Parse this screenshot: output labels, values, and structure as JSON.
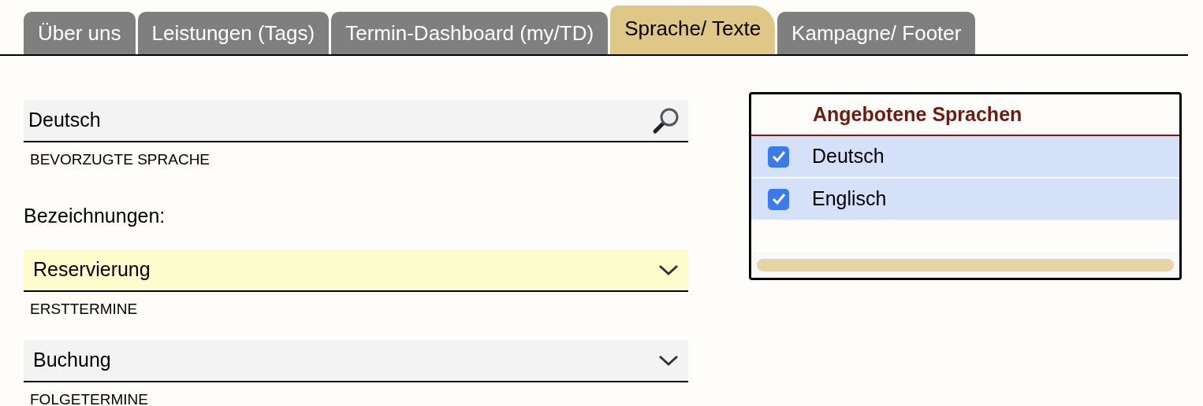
{
  "tabs": [
    {
      "label": "Über uns",
      "selected": false
    },
    {
      "label": "Leistungen (Tags)",
      "selected": false
    },
    {
      "label": "Termin-Dashboard (my/TD)",
      "selected": false
    },
    {
      "label": "Sprache/ Texte",
      "selected": true
    },
    {
      "label": "Kampagne/ Footer",
      "selected": false
    }
  ],
  "preferred_language": {
    "value": "Deutsch",
    "label": "BEVORZUGTE SPRACHE"
  },
  "designations": {
    "heading": "Bezeichnungen:",
    "selects": [
      {
        "value": "Reservierung",
        "label": "ERSTTERMINE",
        "focused": true
      },
      {
        "value": "Buchung",
        "label": "FOLGETERMINE",
        "focused": false
      }
    ]
  },
  "languages": {
    "title": "Angebotene Sprachen",
    "items": [
      {
        "label": "Deutsch",
        "checked": true
      },
      {
        "label": "Englisch",
        "checked": true
      }
    ]
  }
}
